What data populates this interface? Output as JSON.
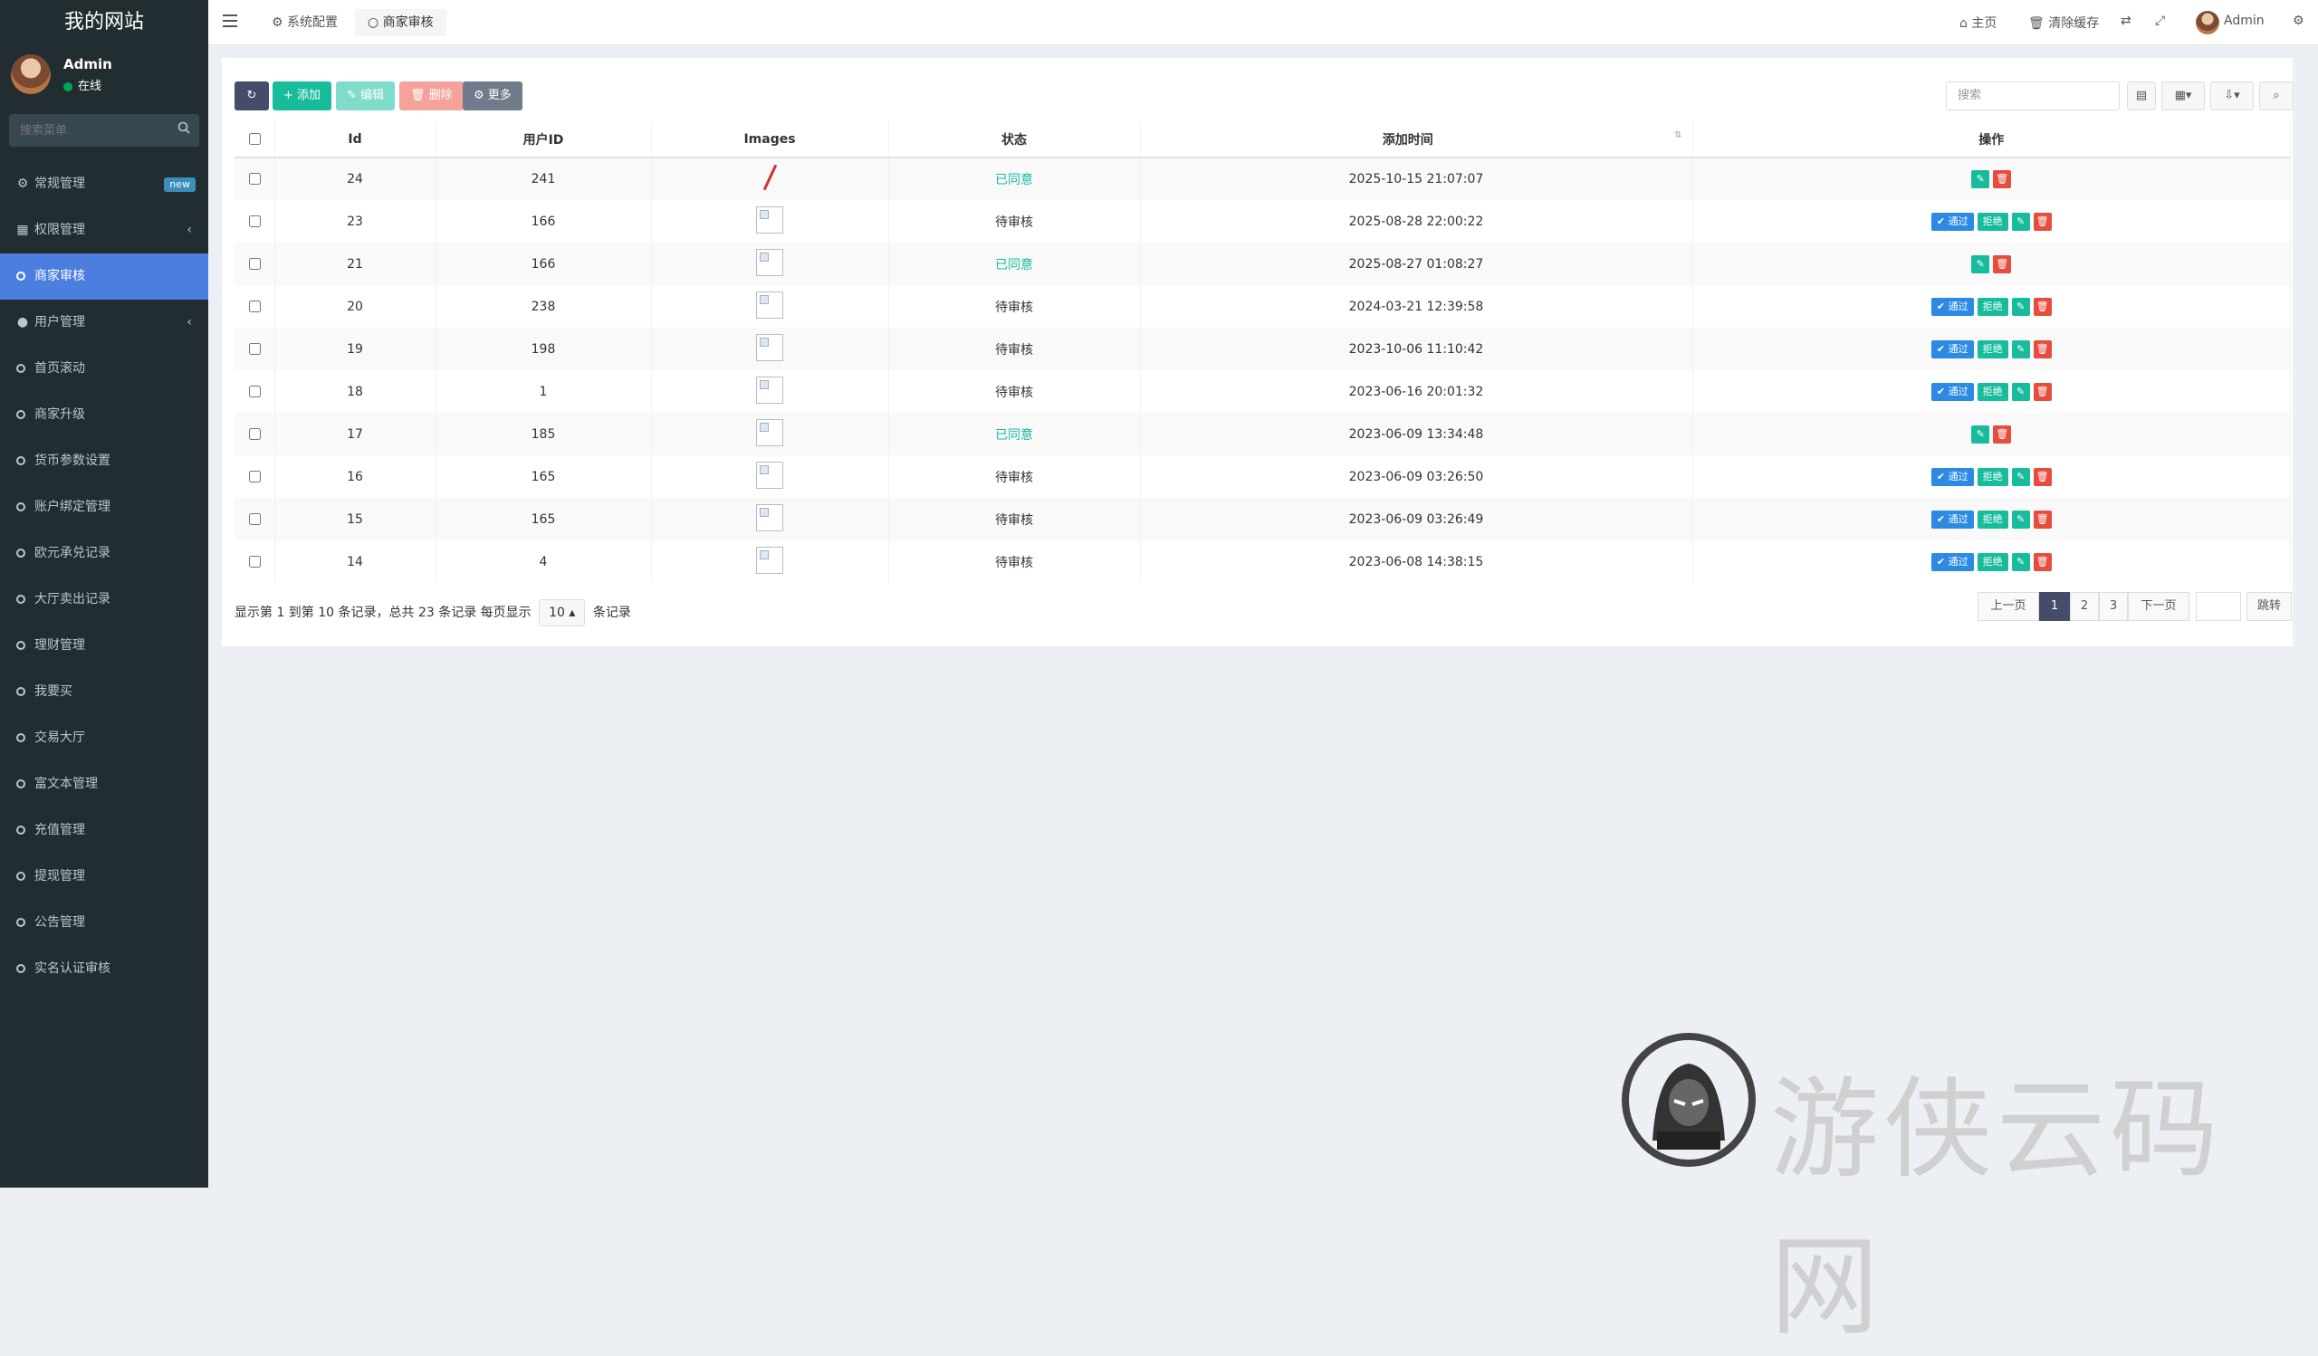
{
  "sidebar": {
    "brand": "我的网站",
    "user": {
      "name": "Admin",
      "status": "在线"
    },
    "search_placeholder": "搜索菜单",
    "items": [
      {
        "label": "常规管理",
        "badge": "new"
      },
      {
        "label": "权限管理",
        "chevron": "‹"
      },
      {
        "label": "商家审核"
      },
      {
        "label": "用户管理",
        "chevron": "‹"
      },
      {
        "label": "首页滚动"
      },
      {
        "label": "商家升级"
      },
      {
        "label": "货币参数设置"
      },
      {
        "label": "账户绑定管理"
      },
      {
        "label": "欧元承兑记录"
      },
      {
        "label": "大厅卖出记录"
      },
      {
        "label": "理财管理"
      },
      {
        "label": "我要买"
      },
      {
        "label": "交易大厅"
      },
      {
        "label": "富文本管理"
      },
      {
        "label": "充值管理"
      },
      {
        "label": "提现管理"
      },
      {
        "label": "公告管理"
      },
      {
        "label": "实名认证审核"
      }
    ]
  },
  "topbar": {
    "tabs": [
      "系统配置",
      "商家审核"
    ],
    "home": "主页",
    "clear_cache": "清除缓存",
    "admin": "Admin"
  },
  "toolbar": {
    "add": "添加",
    "edit": "编辑",
    "delete": "删除",
    "more": "更多",
    "search_placeholder": "搜索"
  },
  "table": {
    "headers": [
      "Id",
      "用户ID",
      "Images",
      "状态",
      "添加时间",
      "操作"
    ],
    "rows": [
      {
        "id": "24",
        "uid": "241",
        "status": "已同意",
        "time": "2025-10-15 21:07:07",
        "approved": true,
        "img": "broken"
      },
      {
        "id": "23",
        "uid": "166",
        "status": "待审核",
        "time": "2025-08-28 22:00:22",
        "approved": false,
        "img": "box"
      },
      {
        "id": "21",
        "uid": "166",
        "status": "已同意",
        "time": "2025-08-27 01:08:27",
        "approved": true,
        "img": "box"
      },
      {
        "id": "20",
        "uid": "238",
        "status": "待审核",
        "time": "2024-03-21 12:39:58",
        "approved": false,
        "img": "box"
      },
      {
        "id": "19",
        "uid": "198",
        "status": "待审核",
        "time": "2023-10-06 11:10:42",
        "approved": false,
        "img": "box"
      },
      {
        "id": "18",
        "uid": "1",
        "status": "待审核",
        "time": "2023-06-16 20:01:32",
        "approved": false,
        "img": "box"
      },
      {
        "id": "17",
        "uid": "185",
        "status": "已同意",
        "time": "2023-06-09 13:34:48",
        "approved": true,
        "img": "box"
      },
      {
        "id": "16",
        "uid": "165",
        "status": "待审核",
        "time": "2023-06-09 03:26:50",
        "approved": false,
        "img": "box"
      },
      {
        "id": "15",
        "uid": "165",
        "status": "待审核",
        "time": "2023-06-09 03:26:49",
        "approved": false,
        "img": "box"
      },
      {
        "id": "14",
        "uid": "4",
        "status": "待审核",
        "time": "2023-06-08 14:38:15",
        "approved": false,
        "img": "box"
      }
    ],
    "actions": {
      "pass": "通过",
      "reject": "拒绝"
    }
  },
  "footer": {
    "summary": "显示第 1 到第 10 条记录，总共 23 条记录 每页显示",
    "per_page": "10",
    "suffix": "条记录"
  },
  "pagination": {
    "prev": "上一页",
    "pages": [
      "1",
      "2",
      "3"
    ],
    "next": "下一页",
    "go": "跳转"
  },
  "watermark": "游侠云码网"
}
